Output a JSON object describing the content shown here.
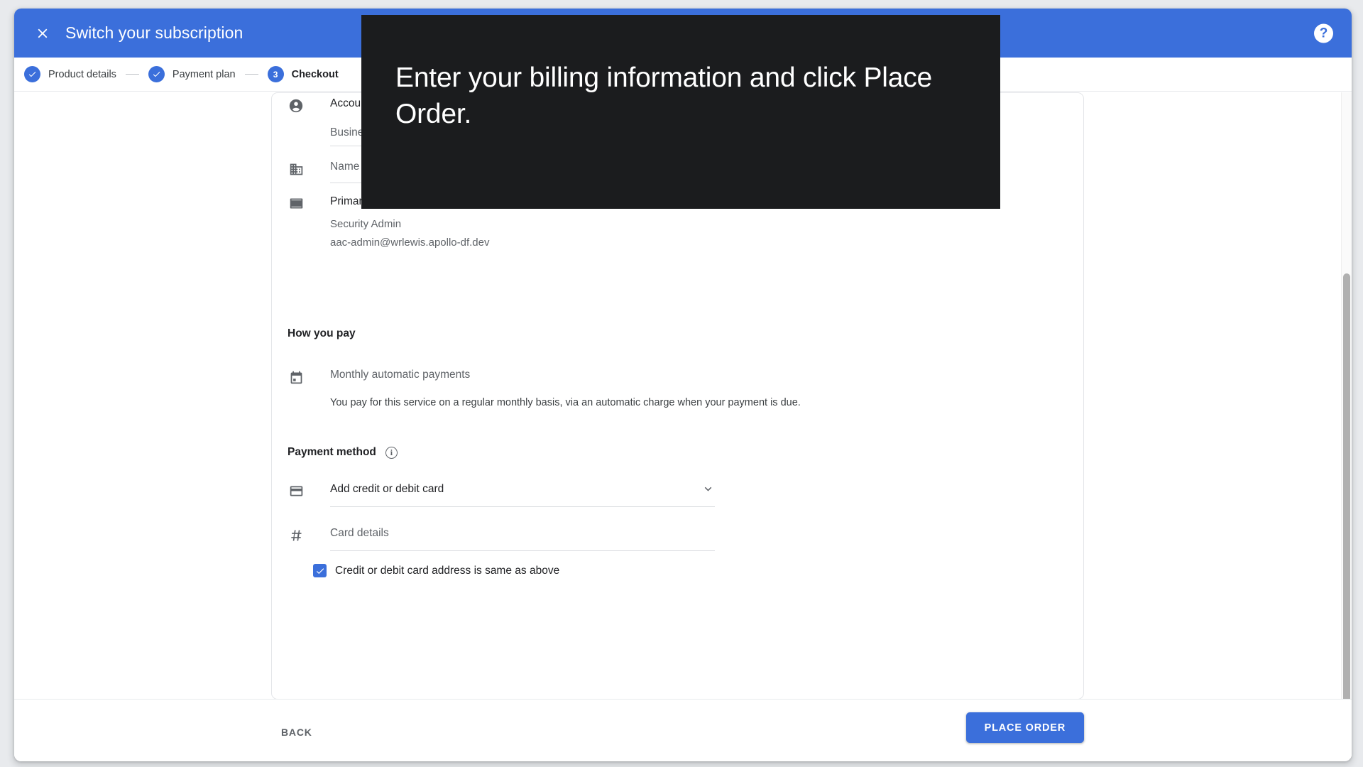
{
  "header": {
    "title": "Switch your subscription",
    "close_icon": "close-icon",
    "help_icon": "help-icon",
    "help_label": "?",
    "accent_color": "#3b6fdb"
  },
  "stepper": {
    "steps": [
      {
        "label": "Product details",
        "badge": "✓",
        "state": "done"
      },
      {
        "label": "Payment plan",
        "badge": "✓",
        "state": "done"
      },
      {
        "label": "Checkout",
        "badge": "3",
        "state": "current"
      }
    ]
  },
  "account": {
    "icon": "person-icon",
    "label": "Accou",
    "value": "Busine"
  },
  "business_name": {
    "icon": "building-icon",
    "placeholder": "Name"
  },
  "primary_contact": {
    "icon": "contact-card-icon",
    "label": "Primary contact",
    "info_icon": "info-icon",
    "edit_icon": "pencil-icon",
    "name": "Security Admin",
    "email": "aac-admin@wrlewis.apollo-df.dev"
  },
  "how_you_pay": {
    "title": "How you pay",
    "icon": "calendar-icon",
    "option": "Monthly automatic payments",
    "description": "You pay for this service on a regular monthly basis, via an automatic charge when your payment is due."
  },
  "payment_method": {
    "title": "Payment method",
    "info_icon": "info-icon",
    "card_icon": "credit-card-icon",
    "selected": "Add credit or debit card",
    "chevron_icon": "chevron-down-icon",
    "card_details_icon": "hash-icon",
    "card_details_placeholder": "Card details",
    "same_address_label": "Credit or debit card address is same as above",
    "same_address_checked": true
  },
  "footer": {
    "back_label": "BACK",
    "place_order_label": "PLACE ORDER"
  },
  "tooltip": {
    "text": "Enter your billing information and click Place Order."
  }
}
